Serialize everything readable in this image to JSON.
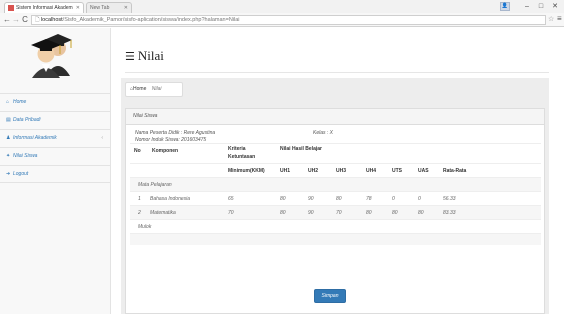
{
  "browser": {
    "tabs": [
      {
        "label": "Sistem Informasi Akadem"
      },
      {
        "label": "New Tab"
      }
    ],
    "url_host": "localhost",
    "url_path": "/Sisfo_Akademik_Pamor/sisfo-aplication/siswa/index.php?halaman=Nilai"
  },
  "sidebar": {
    "items": [
      {
        "icon": "home-icon",
        "label": "Home"
      },
      {
        "icon": "book-icon",
        "label": "Data Pribadi"
      },
      {
        "icon": "user-icon",
        "label": "Informasi Akademik",
        "chevron": "‹"
      },
      {
        "icon": "pin-icon",
        "label": "Nilai Siswa"
      },
      {
        "icon": "logout-icon",
        "label": "Logout"
      }
    ]
  },
  "page": {
    "title": "Nilai",
    "breadcrumb": {
      "home": "Home",
      "current": "Nilai"
    }
  },
  "panel": {
    "heading": "Nilai Siswa",
    "student_name_line": "Nama Peserta Didik : Rere Agustina",
    "student_nis_line": "Nomor Induk Siswa: 201603475",
    "kelas_line": "Kelas : X",
    "table": {
      "headers": {
        "no": "No",
        "komponen": "Komponen",
        "kriteria_1": "Kriteria",
        "kriteria_2": "Ketuntasan",
        "nilai_hasil": "Nilai Hasil Belajar"
      },
      "subheaders": [
        "Minimum(KKM)",
        "UH1",
        "UH2",
        "UH3",
        "UH4",
        "UTS",
        "UAS",
        "Rata-Rata"
      ],
      "group_mapel": "Mata Pelajaran",
      "rows": [
        {
          "no": "1",
          "mapel": "Bahasa Indonesia",
          "kkm": "65",
          "uh1": "80",
          "uh2": "90",
          "uh3": "80",
          "uh4": "78",
          "uts": "0",
          "uas": "0",
          "rata": "56.33"
        },
        {
          "no": "2",
          "mapel": "Matematika",
          "kkm": "70",
          "uh1": "80",
          "uh2": "90",
          "uh3": "70",
          "uh4": "80",
          "uts": "80",
          "uas": "80",
          "rata": "83.33"
        }
      ],
      "group_mulok": "Mulok"
    },
    "save_label": "Simpan"
  },
  "colors": {
    "link": "#337ab7",
    "button": "#337ab7"
  }
}
